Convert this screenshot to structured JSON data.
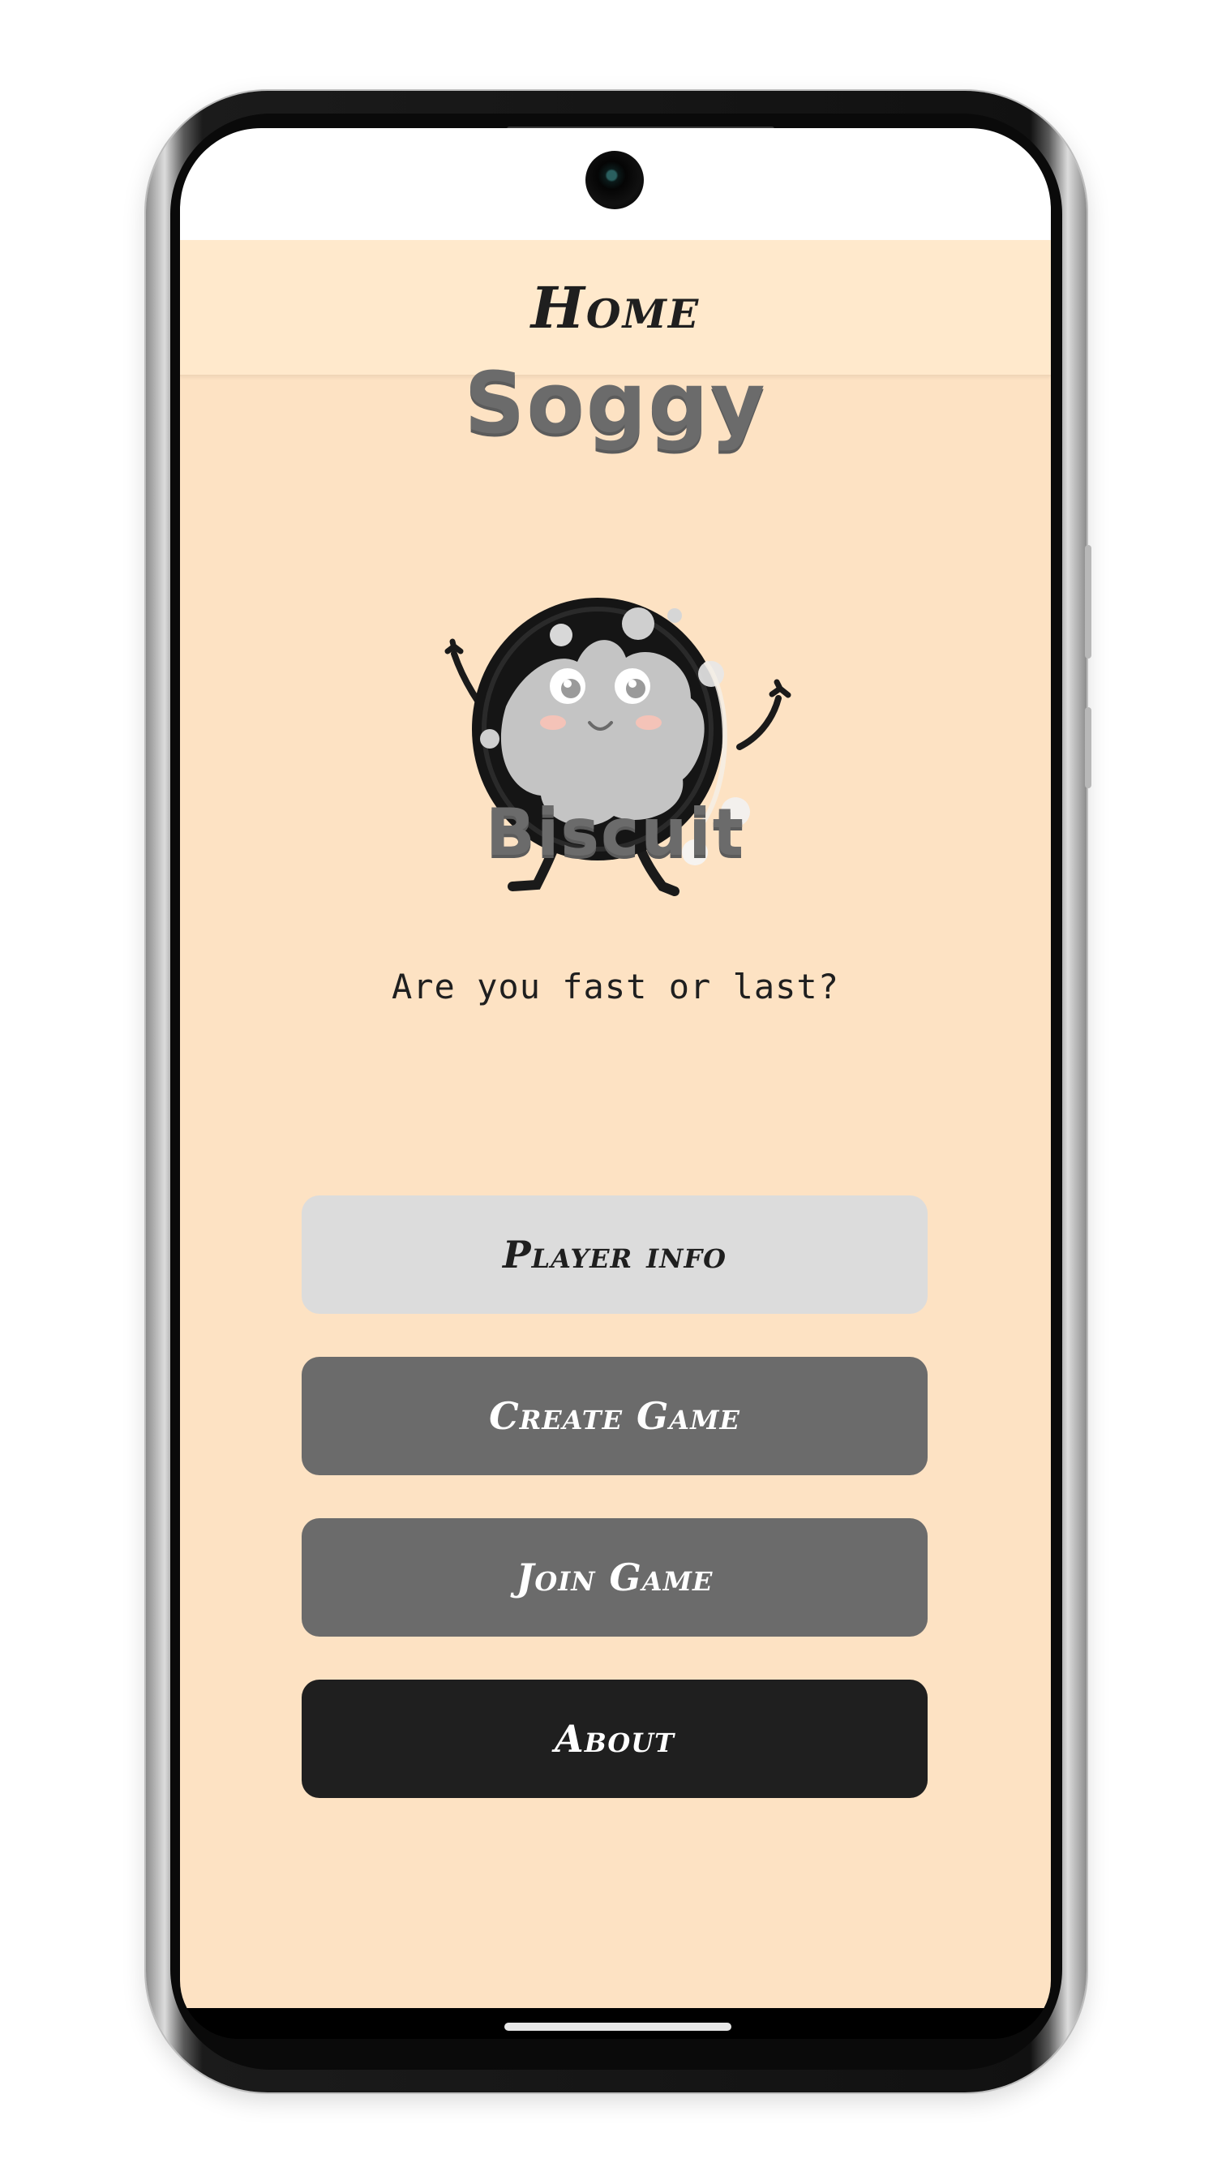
{
  "header": {
    "title": "Home"
  },
  "logo": {
    "top_word": "Soggy",
    "bottom_word": "Biscuit",
    "mascot_icon": "biscuit-mascot-icon"
  },
  "tagline": "Are you fast or last?",
  "menu": {
    "player_info": "Player info",
    "create_game": "Create Game",
    "join_game": "Join Game",
    "about": "About"
  },
  "colors": {
    "background": "#fde2c3",
    "header": "#ffe9cc",
    "button_light": "#dcdcdc",
    "button_mid": "#6b6b6b",
    "button_dark": "#1f1f1f",
    "logo_text": "#6b6b6b"
  }
}
